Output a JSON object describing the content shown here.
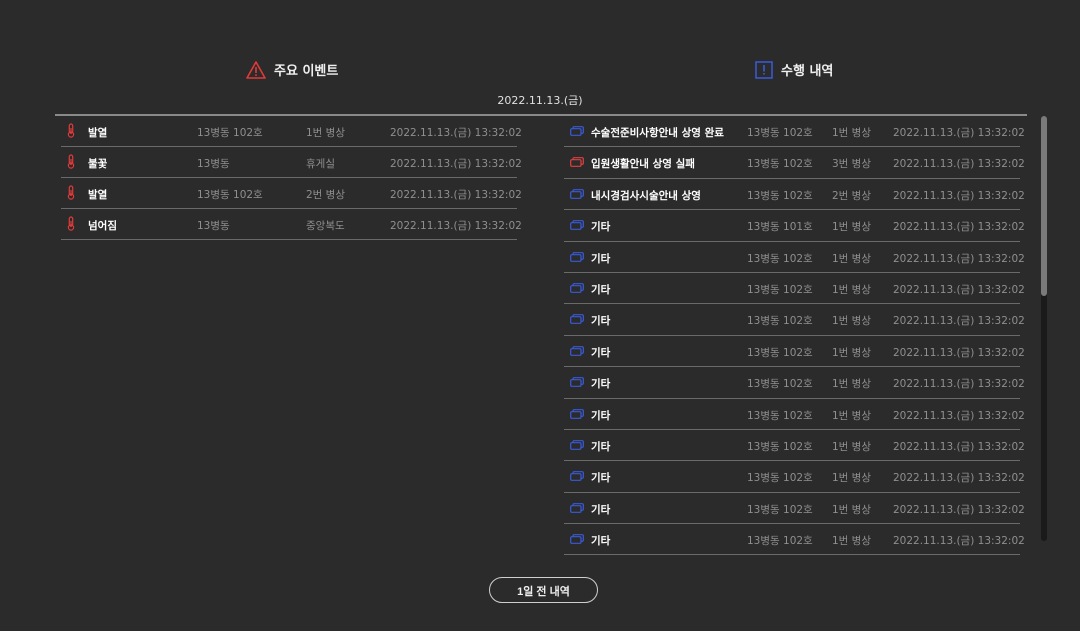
{
  "events_panel": {
    "title": "주요 이벤트",
    "icon": "warning-triangle-icon",
    "icon_color": "#e03a3a",
    "rows": [
      {
        "name": "발열",
        "ward": "13병동 102호",
        "location": "1번 병상",
        "time": "2022.11.13.(금) 13:32:02"
      },
      {
        "name": "불꽃",
        "ward": "13병동",
        "location": "휴게실",
        "time": "2022.11.13.(금) 13:32:02"
      },
      {
        "name": "발열",
        "ward": "13병동 102호",
        "location": "2번 병상",
        "time": "2022.11.13.(금) 13:32:02"
      },
      {
        "name": "넘어짐",
        "ward": "13병동",
        "location": "중앙복도",
        "time": "2022.11.13.(금) 13:32:02"
      }
    ]
  },
  "tasks_panel": {
    "title": "수행 내역",
    "icon": "exclamation-box-icon",
    "icon_color": "#3a5bd9",
    "rows": [
      {
        "name": "수술전준비사항안내 상영 완료",
        "ward": "13병동 102호",
        "bed": "1번 병상",
        "time": "2022.11.13.(금) 13:32:02",
        "status": "ok"
      },
      {
        "name": "입원생활안내 상영 실패",
        "ward": "13병동 102호",
        "bed": "3번 병상",
        "time": "2022.11.13.(금) 13:32:02",
        "status": "fail"
      },
      {
        "name": "내시경검사시술안내 상영",
        "ward": "13병동 102호",
        "bed": "2번 병상",
        "time": "2022.11.13.(금) 13:32:02",
        "status": "ok"
      },
      {
        "name": "기타",
        "ward": "13병동 101호",
        "bed": "1번 병상",
        "time": "2022.11.13.(금) 13:32:02",
        "status": "ok"
      },
      {
        "name": "기타",
        "ward": "13병동 102호",
        "bed": "1번 병상",
        "time": "2022.11.13.(금) 13:32:02",
        "status": "ok"
      },
      {
        "name": "기타",
        "ward": "13병동 102호",
        "bed": "1번 병상",
        "time": "2022.11.13.(금) 13:32:02",
        "status": "ok"
      },
      {
        "name": "기타",
        "ward": "13병동 102호",
        "bed": "1번 병상",
        "time": "2022.11.13.(금) 13:32:02",
        "status": "ok"
      },
      {
        "name": "기타",
        "ward": "13병동 102호",
        "bed": "1번 병상",
        "time": "2022.11.13.(금) 13:32:02",
        "status": "ok"
      },
      {
        "name": "기타",
        "ward": "13병동 102호",
        "bed": "1번 병상",
        "time": "2022.11.13.(금) 13:32:02",
        "status": "ok"
      },
      {
        "name": "기타",
        "ward": "13병동 102호",
        "bed": "1번 병상",
        "time": "2022.11.13.(금) 13:32:02",
        "status": "ok"
      },
      {
        "name": "기타",
        "ward": "13병동 102호",
        "bed": "1번 병상",
        "time": "2022.11.13.(금) 13:32:02",
        "status": "ok"
      },
      {
        "name": "기타",
        "ward": "13병동 102호",
        "bed": "1번 병상",
        "time": "2022.11.13.(금) 13:32:02",
        "status": "ok"
      },
      {
        "name": "기타",
        "ward": "13병동 102호",
        "bed": "1번 병상",
        "time": "2022.11.13.(금) 13:32:02",
        "status": "ok"
      },
      {
        "name": "기타",
        "ward": "13병동 102호",
        "bed": "1번 병상",
        "time": "2022.11.13.(금) 13:32:02",
        "status": "ok"
      }
    ]
  },
  "date": "2022.11.13.(금)",
  "history_button": "1일 전 내역",
  "colors": {
    "background": "#2b2b2b",
    "alert_red": "#e03a3a",
    "task_blue": "#3a5bd9",
    "fail_red": "#e04040"
  }
}
